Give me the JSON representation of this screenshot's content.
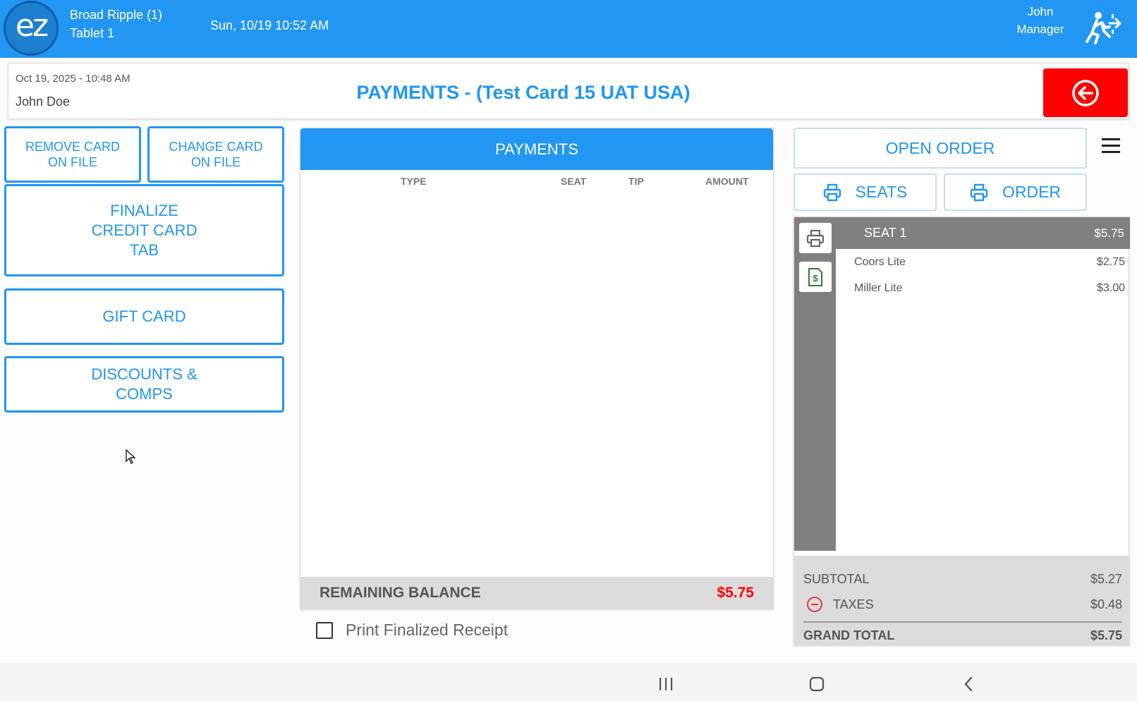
{
  "topbar": {
    "logo_text": "ez",
    "location": "Broad Ripple (1)",
    "device": "Tablet 1",
    "datetime": "Sun, 10/19 10:52 AM",
    "user_name": "John",
    "user_role": "Manager",
    "logout_icon": "walk-out-icon",
    "bg_color": "#2196f3"
  },
  "header": {
    "date": "Oct 19, 2025  - 10:48 AM",
    "customer": "John Doe",
    "title": "PAYMENTS - (Test Card 15 UAT USA)",
    "back_icon": "arrow-left-circle-icon"
  },
  "left_actions": {
    "remove_card": "REMOVE CARD\nON FILE",
    "change_card": "CHANGE CARD\nON FILE",
    "finalize_tab": "FINALIZE\nCREDIT CARD\nTAB",
    "gift_card": "GIFT CARD",
    "discounts": "DISCOUNTS &\nCOMPS"
  },
  "payments": {
    "heading": "PAYMENTS",
    "columns": [
      "TYPE",
      "SEAT",
      "TIP",
      "AMOUNT"
    ],
    "rows": [],
    "remaining_label": "REMAINING BALANCE",
    "remaining_value": "$5.75",
    "print_receipt_label": "Print Finalized Receipt",
    "print_receipt_checked": false
  },
  "order": {
    "open_order": "OPEN ORDER",
    "seats_btn": "SEATS",
    "order_btn": "ORDER",
    "seat_name": "SEAT 1",
    "seat_total": "$5.75",
    "items": [
      {
        "name": "Coors Lite",
        "price": "$2.75"
      },
      {
        "name": "Miller Lite",
        "price": "$3.00"
      }
    ],
    "subtotal_label": "SUBTOTAL",
    "subtotal": "$5.27",
    "taxes_label": "TAXES",
    "taxes": "$0.48",
    "grand_total_label": "GRAND TOTAL",
    "grand_total": "$5.75"
  },
  "colors": {
    "accent": "#2196f3",
    "danger": "#ff0000",
    "receipt_green": "#2e7d32"
  }
}
